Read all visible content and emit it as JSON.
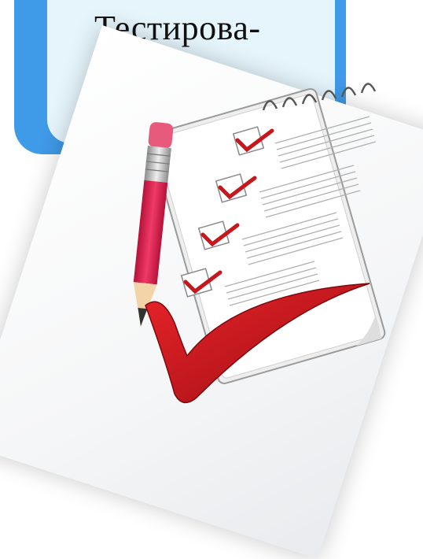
{
  "slide": {
    "title_text": "Тестирова-"
  },
  "illustration": {
    "checkmark_color": "#c8161d",
    "pencil_color": "#d81f48",
    "frame_color": "#3f9ae8",
    "card_color": "#e6f5fc"
  }
}
